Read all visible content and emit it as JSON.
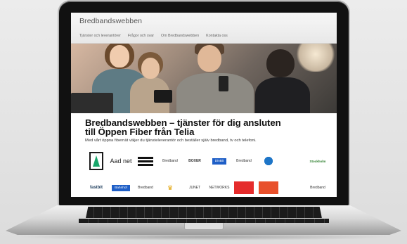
{
  "site": {
    "title": "Bredbandswebben",
    "nav": [
      "Tjänster och leverantörer",
      "Frågor och svar",
      "Om Bredbandswebben",
      "Kontakta oss"
    ]
  },
  "hero": {
    "headline_line1": "Bredbandswebben – tjänster för dig ansluten",
    "headline_line2": "till Öppen Fiber från Telia",
    "subtitle": "Med vårt öppna fibernät väljer du tjänsteleverantör och beställer själv bredband, tv och telefoni."
  },
  "logos": {
    "row1": [
      "",
      "Aad net",
      "",
      "Bredband",
      "BOXER",
      "DinBit",
      "Bredband",
      "",
      "",
      "Stockholm"
    ],
    "row2": [
      "fastbit",
      "Bahnhof",
      "Bredband",
      "",
      "JUNET",
      "NETWORKS",
      "",
      "",
      "",
      "Bredband"
    ]
  },
  "colors": {
    "accent_green": "#17a66a",
    "telia_blue": "#1d75c7"
  }
}
